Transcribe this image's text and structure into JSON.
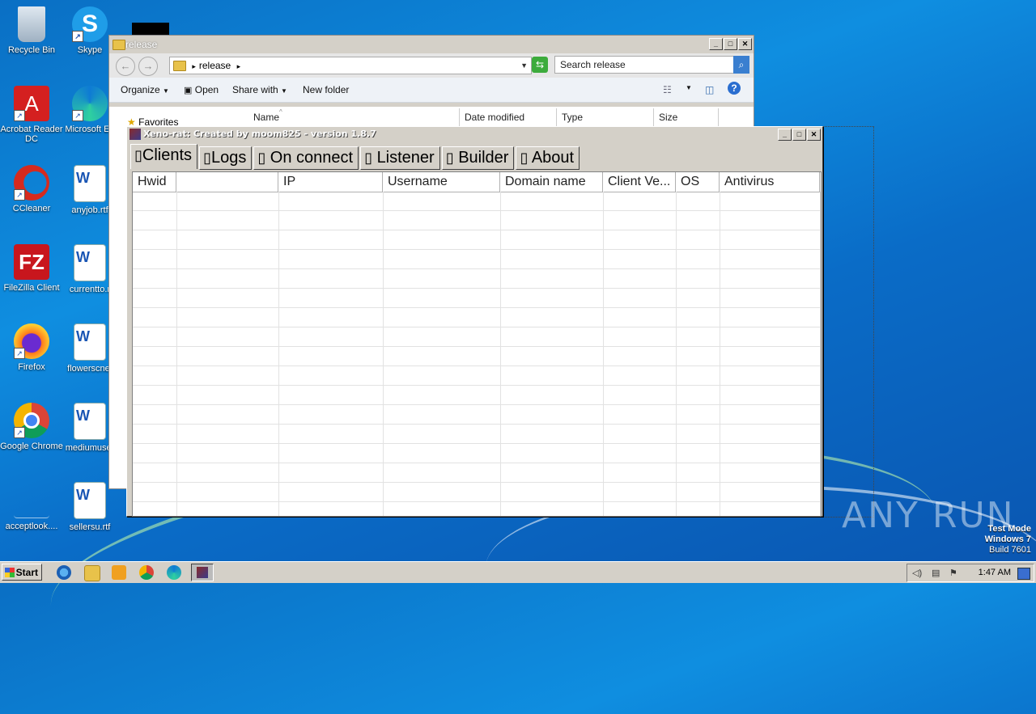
{
  "desktop": {
    "icons": [
      {
        "label": "Recycle Bin"
      },
      {
        "label": "Skype"
      },
      {
        "label": "Acrobat Reader DC"
      },
      {
        "label": "Microsoft Ed"
      },
      {
        "label": "CCleaner"
      },
      {
        "label": "anyjob.rtf"
      },
      {
        "label": "FileZilla Client"
      },
      {
        "label": "currentto.r"
      },
      {
        "label": "Firefox"
      },
      {
        "label": "flowerscnet"
      },
      {
        "label": "Google Chrome"
      },
      {
        "label": "mediumuser"
      },
      {
        "label": "acceptlook...."
      },
      {
        "label": "sellersu.rtf"
      }
    ]
  },
  "explorer": {
    "title": "release",
    "address": "release",
    "search_placeholder": "Search release",
    "toolbar": {
      "organize": "Organize",
      "open": "Open",
      "share_with": "Share with",
      "new_folder": "New folder"
    },
    "columns": [
      "Name",
      "Date modified",
      "Type",
      "Size"
    ],
    "nav": {
      "favorites": "Favorites"
    }
  },
  "xeno": {
    "title": "Xeno-rat: Created by moom825 - version 1.8.7",
    "tabs": [
      "Clients",
      "Logs",
      "On connect",
      "Listener",
      "Builder",
      "About"
    ],
    "active_tab": "Clients",
    "columns": [
      "Hwid",
      "",
      "IP",
      "Username",
      "Domain name",
      "Client Ve...",
      "OS",
      "Antivirus"
    ],
    "row_count": 16
  },
  "watermark": "ANY RUN",
  "test_mode": {
    "line1": "Test Mode",
    "line2": "Windows 7",
    "line3": "Build 7601"
  },
  "taskbar": {
    "start": "Start",
    "clock": "1:47 AM"
  }
}
